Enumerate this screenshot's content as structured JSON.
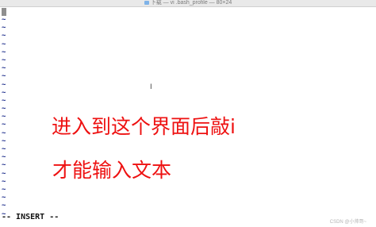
{
  "window": {
    "title": "下载 — vi .bash_profile — 80×24",
    "title_icon": "folder-icon"
  },
  "editor": {
    "empty_line_marker": "~",
    "empty_line_count": 25,
    "mode_indicator": "-- INSERT --"
  },
  "annotations": {
    "line1": "进入到这个界面后敲i",
    "line2": "才能输入文本",
    "color": "#ee1111"
  },
  "watermark": "CSDN @小帅哥~"
}
